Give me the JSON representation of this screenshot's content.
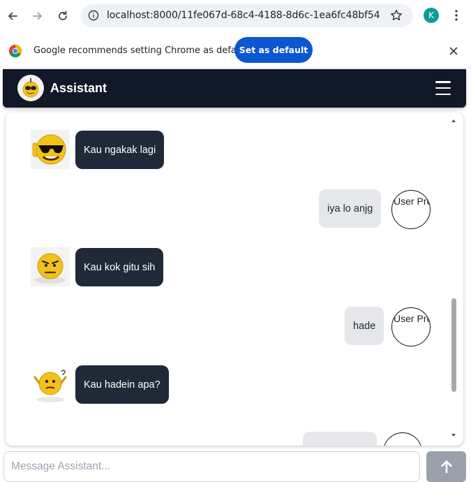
{
  "browser": {
    "url": "localhost:8000/11fe067d-68c4-4188-8d6c-1ea6fc48bf54",
    "profile_initial": "K",
    "icons": {
      "back": "back-arrow-icon",
      "forward": "forward-arrow-icon",
      "reload": "reload-icon",
      "site_info": "site-info-icon",
      "bookmark": "star-icon",
      "menu": "vertical-dots-icon"
    }
  },
  "infobar": {
    "message": "Google recommends setting Chrome as default",
    "button_label": "Set as default",
    "icons": {
      "logo": "chrome-logo-icon",
      "close": "close-icon"
    }
  },
  "header": {
    "title": "Assistant",
    "icons": {
      "avatar": "emoji-avatar",
      "menu": "hamburger-menu-icon"
    },
    "colors": {
      "background": "#111827"
    }
  },
  "chat": {
    "messages": [
      {
        "role": "assistant",
        "text": "Kau ngakak lagi",
        "avatar": "sunglasses-emoji-icon"
      },
      {
        "role": "user",
        "text": "iya lo anjg",
        "avatar_alt": "User Profile"
      },
      {
        "role": "assistant",
        "text": "Kau kok gitu sih",
        "avatar": "annoyed-emoji-icon"
      },
      {
        "role": "user",
        "text": "hade",
        "avatar_alt": "User Profile"
      },
      {
        "role": "assistant",
        "text": "Kau hadein apa?",
        "avatar": "shrugging-emoji-icon"
      }
    ],
    "colors": {
      "assistant_bubble": "#1f2937",
      "user_bubble": "#e5e7eb"
    }
  },
  "composer": {
    "placeholder": "Message Assistant...",
    "value": "",
    "send_icon": "arrow-up-icon"
  }
}
